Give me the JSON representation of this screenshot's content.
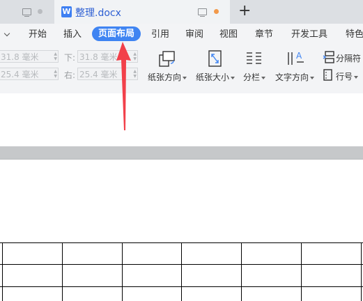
{
  "tabs": {
    "active_title": "整理.docx",
    "active_icon_letter": "W"
  },
  "menu": {
    "items": [
      "开始",
      "插入",
      "页面布局",
      "引用",
      "审阅",
      "视图",
      "章节",
      "开发工具",
      "特色"
    ],
    "active": "页面布局"
  },
  "margins": {
    "top_value": "31.8 毫米",
    "left_value": "25.4 毫米",
    "bottom_label": "下:",
    "bottom_value": "31.8 毫米",
    "right_label": "右:",
    "right_value": "25.4 毫米"
  },
  "ribbon": {
    "orientation": "纸张方向",
    "size": "纸张大小",
    "columns": "分栏",
    "text_direction": "文字方向",
    "breaks": "分隔符",
    "line_numbers": "行号"
  },
  "colors": {
    "accent": "#3f84f2",
    "annotation_arrow": "#f2404a"
  }
}
